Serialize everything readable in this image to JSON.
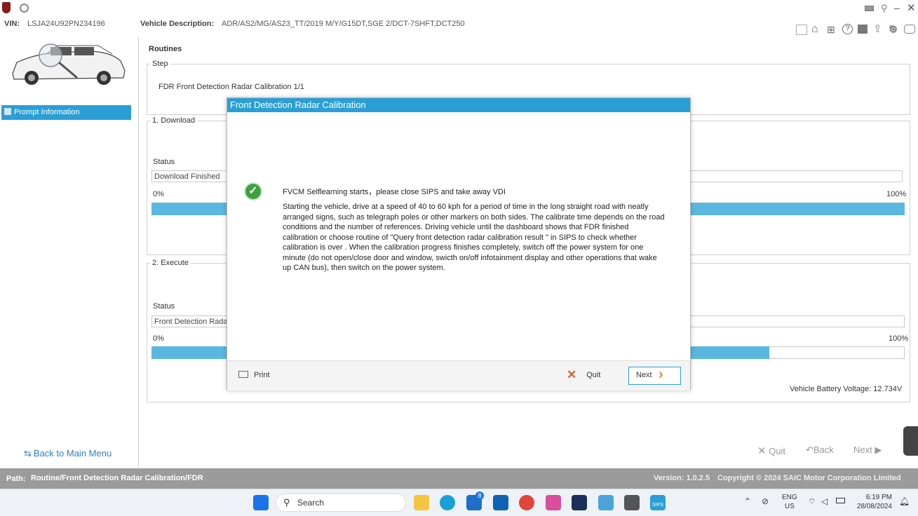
{
  "vin": {
    "label": "VIN:",
    "value": "LSJA24U92PN234196"
  },
  "vehicle_description": {
    "label": "Vehicle Description:",
    "value": "ADR/AS2/MG/AS23_TT/2019 M/Y/G15DT,SGE 2/DCT-7SHFT,DCT250"
  },
  "sidebar": {
    "prompt_info_label": "Prompt Information",
    "back_label": "Back to Main Menu"
  },
  "main": {
    "section_title": "Routines",
    "step_title": "Step",
    "step_value": "FDR Front Detection Radar Calibration 1/1",
    "download": {
      "title": "1. Download",
      "status_label": "Status",
      "status_value": "Download Finished",
      "pct_start": "0%",
      "pct_end": "100%",
      "progress": 1.0
    },
    "execute": {
      "title": "2. Execute",
      "status_label": "Status",
      "status_value": "Front Detection Radar Calibration",
      "pct_start": "0%",
      "pct_end": "100%",
      "progress": 0.82
    },
    "battery_voltage": "Vehicle Battery Voltage: 12.734V"
  },
  "dialog": {
    "title": "Front Detection Radar Calibration",
    "headline": "FVCM Selflearning starts，please close SIPS and take away VDI",
    "body": "Starting the vehicle, drive at a speed of 40 to 60 kph for a period of time in the long straight road with neatly arranged signs, such as telegraph poles or other markers on both sides. The calibrate time depends on the road conditions and the number of references. Driving vehicle until the dashboard shows that FDR finished calibration or choose routine of    \"Query front detection radar calibration result \"    in SIPS to check whether calibration is over . When the calibration progress finishes completely, switch off the power system for one minute (do not open/close door and window, swicth on/off infotainment display and other operations that wake up CAN bus), then switch on the power system.",
    "print_label": "Print",
    "quit_label": "Quit",
    "next_label": "Next"
  },
  "bottom_nav": {
    "quit": "Quit",
    "back": "Back",
    "next": "Next"
  },
  "status_bar": {
    "path_label": "Path:",
    "path_value": "Routine/Front Detection Radar Calibration/FDR",
    "version": "Version:  1.0.2.5",
    "copyright": "Copyright © 2024 SAIC Motor Corporation Limited"
  },
  "taskbar": {
    "search_placeholder": "Search",
    "lang_top": "ENG",
    "lang_bottom": "US",
    "time": "6:19 PM",
    "date": "28/08/2024",
    "badge_count": "8",
    "sips_label": "SIPS"
  },
  "colors": {
    "accent": "#2a9fd6",
    "progress": "#5ab8e0",
    "statusbar": "#9b9b9b",
    "next_arrow": "#e8873a"
  }
}
